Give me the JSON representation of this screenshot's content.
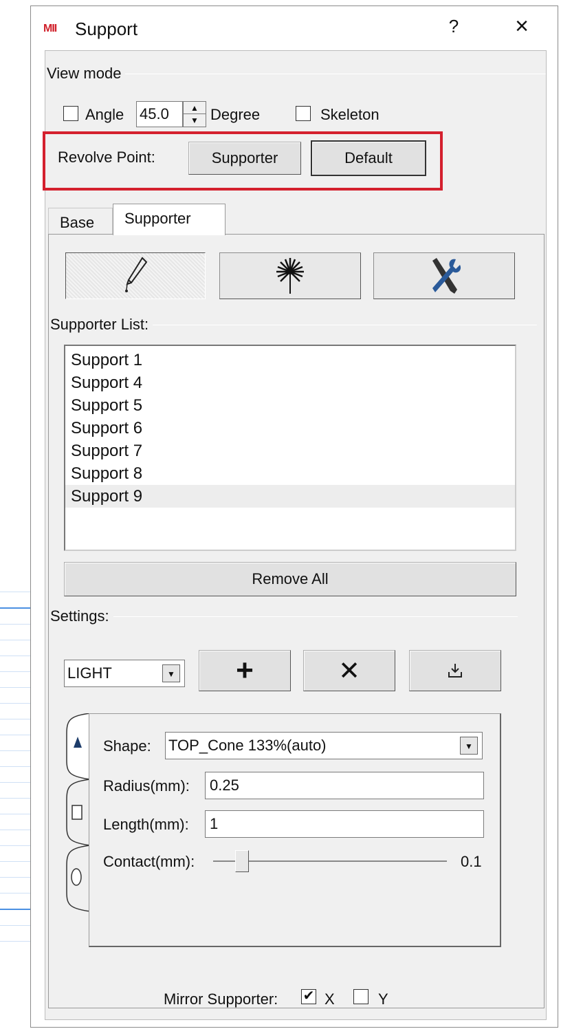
{
  "window": {
    "logo": "MII",
    "title": "Support",
    "help": "?",
    "close": "×"
  },
  "view_mode": {
    "label": "View mode",
    "angle_label": "Angle",
    "angle_value": "45.0",
    "degree_label": "Degree",
    "skeleton_label": "Skeleton",
    "revolve_label": "Revolve Point:",
    "supporter_button": "Supporter",
    "default_button": "Default"
  },
  "tabs": [
    {
      "label": "Base"
    },
    {
      "label": "Supporter"
    }
  ],
  "supporter_list": {
    "label": "Supporter List:",
    "items": [
      "Support 1",
      "Support 4",
      "Support 5",
      "Support 6",
      "Support 7",
      "Support 8",
      "Support 9"
    ],
    "selected": "Support 9",
    "remove_all": "Remove All"
  },
  "settings": {
    "label": "Settings:",
    "profile": "LIGHT",
    "add_symbol": "+",
    "delete_symbol": "✕",
    "shape_label": "Shape:",
    "shape_value": "TOP_Cone 133%(auto)",
    "radius_label": "Radius(mm):",
    "radius_value": "0.25",
    "length_label": "Length(mm):",
    "length_value": "1",
    "contact_label": "Contact(mm):",
    "contact_value": "0.1"
  },
  "mirror": {
    "label": "Mirror Supporter:",
    "x_label": "X",
    "y_label": "Y",
    "x_checked": "✔"
  },
  "colors": {
    "highlight": "#d4202e",
    "logo": "#d0202a",
    "tool_icon": "#2a5a9a"
  },
  "icons": [
    "pen-icon",
    "dandelion-icon",
    "tools-icon",
    "plus-icon",
    "x-icon",
    "export-icon",
    "cone-icon",
    "cylinder-icon",
    "circle-icon"
  ]
}
